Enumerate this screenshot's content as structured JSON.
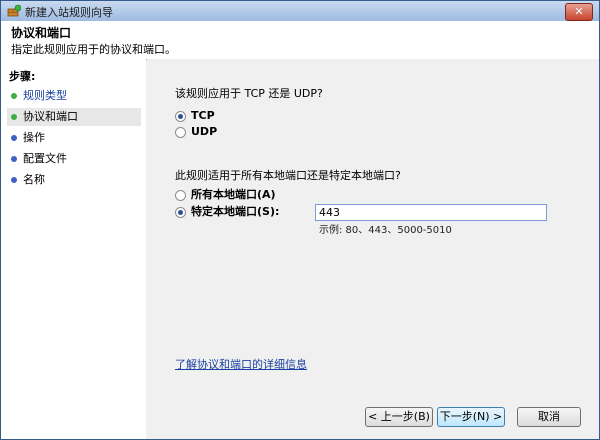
{
  "window": {
    "title": "新建入站规则向导",
    "close": "✕"
  },
  "header": {
    "title": "协议和端口",
    "subtitle": "指定此规则应用于的协议和端口。"
  },
  "sidebar": {
    "steps_label": "步骤:",
    "items": [
      {
        "label": "规则类型",
        "state": "done",
        "bullet_color": "#3cb043"
      },
      {
        "label": "协议和端口",
        "state": "current",
        "bullet_color": "#3cb043"
      },
      {
        "label": "操作",
        "state": "pending",
        "bullet_color": "#3b62c4"
      },
      {
        "label": "配置文件",
        "state": "pending",
        "bullet_color": "#3b62c4"
      },
      {
        "label": "名称",
        "state": "pending",
        "bullet_color": "#3b62c4"
      }
    ]
  },
  "protocol": {
    "question": "该规则应用于 TCP 还是 UDP?",
    "options": [
      {
        "label": "TCP",
        "checked": true
      },
      {
        "label": "UDP",
        "checked": false
      }
    ]
  },
  "ports": {
    "question": "此规则适用于所有本地端口还是特定本地端口?",
    "options": [
      {
        "label": "所有本地端口(A)",
        "checked": false
      },
      {
        "label": "特定本地端口(S):",
        "checked": true
      }
    ],
    "value": "443",
    "example": "示例: 80、443、5000-5010"
  },
  "link": "了解协议和端口的详细信息",
  "buttons": {
    "back": "< 上一步(B)",
    "next": "下一步(N) >",
    "cancel": "取消"
  }
}
